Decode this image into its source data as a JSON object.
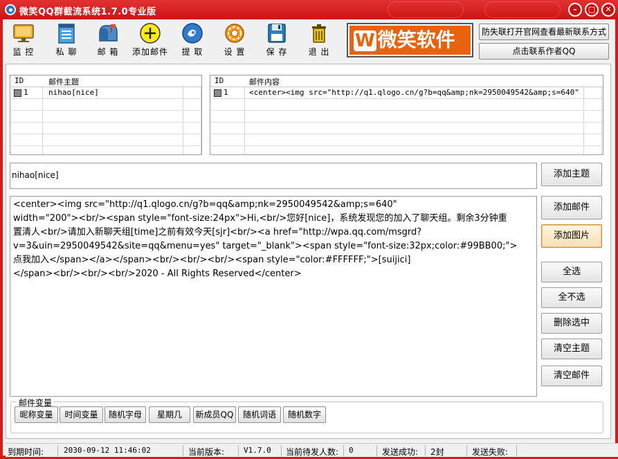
{
  "window": {
    "title": "微笑QQ群截流系统1.7.0专业版"
  },
  "toolbar": [
    {
      "label": "监 控",
      "icon": "monitor-icon"
    },
    {
      "label": "私 聊",
      "icon": "notepad-icon"
    },
    {
      "label": "邮 箱",
      "icon": "mailbox-icon"
    },
    {
      "label": "添加邮件",
      "icon": "add-circle-icon"
    },
    {
      "label": "提 取",
      "icon": "extract-globe-icon"
    },
    {
      "label": "设 置",
      "icon": "gear-icon"
    },
    {
      "label": "保 存",
      "icon": "floppy-disk-icon"
    },
    {
      "label": "退 出",
      "icon": "trash-exit-icon"
    }
  ],
  "logo": {
    "w": "W",
    "text": "微笑软件"
  },
  "top_buttons": {
    "official_site": "防失联打开官网查看最新联系方式",
    "contact_author": "点击联系作者QQ"
  },
  "subject_grid": {
    "headers": [
      "ID",
      "邮件主题"
    ],
    "rows": [
      {
        "id": "1",
        "subject": "nihao[nice]"
      }
    ]
  },
  "content_grid": {
    "headers": [
      "ID",
      "邮件内容"
    ],
    "rows": [
      {
        "id": "1",
        "content": "<center><img src=\"http://q1.qlogo.cn/g?b=qq&amp;nk=2950049542&amp;s=640\" wid..."
      }
    ]
  },
  "subject_field": {
    "value": "nihao[nice]"
  },
  "content_field": {
    "lines": [
      "<center><img src=\"http://q1.qlogo.cn/g?b=qq&amp;nk=2950049542&amp;s=640\"",
      "width=\"200\"><br/><span style=\"font-size:24px\">Hi,<br/>您好[nice]，系统发现您的加入了聊天组。剩余3分钟重",
      "置清人<br/>请加入新聊天组[time]之前有效今天[sjr]<br/><a href=\"http://wpa.qq.com/msgrd?",
      "v=3&uin=2950049542&site=qq&menu=yes\" target=\"_blank\"><span style=\"font-size:32px;color:#99BB00;\">",
      "点我加入</span></a></span><br/><br/><br/><span style=\"color:#FFFFFF;\">[suijici]",
      "</span><br/><br/><br/>2020 - All Rights Reserved</center>"
    ]
  },
  "side_buttons": {
    "add_subject": "添加主题",
    "add_mail": "添加邮件",
    "add_image": "添加图片",
    "select_all": "全选",
    "select_none": "全不选",
    "delete_selected": "删除选中",
    "clear_subjects": "清空主题",
    "clear_mails": "清空邮件"
  },
  "mail_vars": {
    "legend": "邮件变量",
    "buttons": [
      "昵称变量",
      "时间变量",
      "随机字母",
      "星期几",
      "新成员QQ",
      "随机词语",
      "随机数字"
    ]
  },
  "status": {
    "expire_label": "到期时间:",
    "expire_value": "2030-09-12 11:46:02",
    "version_label": "当前版本:",
    "version_value": "V1.7.0",
    "pending_label": "当前待发人数:",
    "pending_value": "0",
    "success_label": "发送成功:",
    "success_value": "2封",
    "fail_label": "发送失败:",
    "fail_value": ""
  },
  "colors": {
    "title_bar": "#d41a1a",
    "logo_orange": "#e8620f",
    "active_button": "#f3dfb8"
  }
}
